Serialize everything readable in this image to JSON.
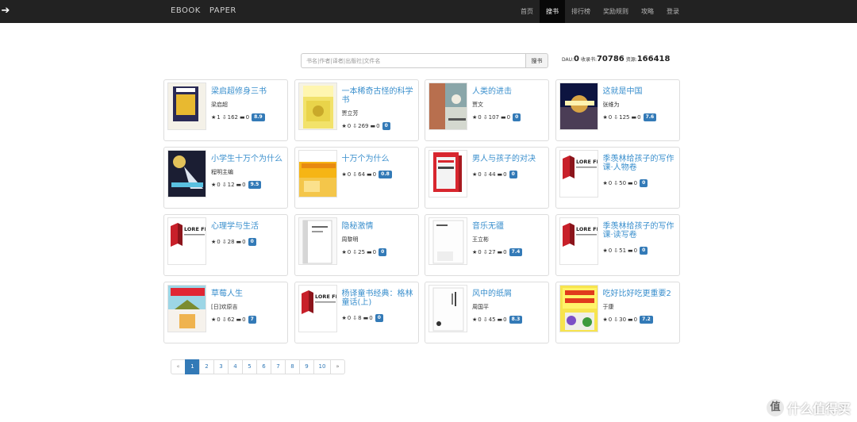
{
  "nav": {
    "back_icon": "arrow-right-icon",
    "brand": "EBOOK   PAPER",
    "items": [
      {
        "label": "首页",
        "active": false
      },
      {
        "label": "搜书",
        "active": true
      },
      {
        "label": "排行榜",
        "active": false
      },
      {
        "label": "奖励规则",
        "active": false
      },
      {
        "label": "攻略",
        "active": false
      },
      {
        "label": "登录",
        "active": false
      }
    ]
  },
  "search": {
    "placeholder": "书名|作者|译者|出版社|文件名",
    "button": "搜书"
  },
  "stats": {
    "dau_label": "DAU:",
    "dau_value": "0",
    "books_label": "收录书:",
    "books_value": "70786",
    "resources_label": "资源:",
    "resources_value": "166418"
  },
  "books": [
    {
      "title": "梁启超修身三书",
      "author": "梁启超",
      "likes": "1",
      "downloads": "162",
      "comments": "0",
      "score": "8.9",
      "cover": "purple-yellow"
    },
    {
      "title": "一本稀奇古怪的科学书",
      "author": "贾立芳",
      "likes": "0",
      "downloads": "269",
      "comments": "0",
      "score": "0",
      "cover": "yellow-book"
    },
    {
      "title": "人类的进击",
      "author": "贾文",
      "likes": "0",
      "downloads": "107",
      "comments": "0",
      "score": "0",
      "cover": "human"
    },
    {
      "title": "这就是中国",
      "author": "张维为",
      "likes": "0",
      "downloads": "125",
      "comments": "0",
      "score": "7.6",
      "cover": "china"
    },
    {
      "title": "小学生十万个为什么",
      "author": "程明主编",
      "likes": "0",
      "downloads": "12",
      "comments": "0",
      "score": "9.5",
      "cover": "space"
    },
    {
      "title": "十万个为什么",
      "author": "",
      "likes": "0",
      "downloads": "64",
      "comments": "0",
      "score": "0.8",
      "cover": "orange"
    },
    {
      "title": "男人与孩子的对决",
      "author": "",
      "likes": "0",
      "downloads": "44",
      "comments": "0",
      "score": "0",
      "cover": "red-box"
    },
    {
      "title": "季羡林给孩子的写作课·人物卷",
      "author": "",
      "likes": "0",
      "downloads": "50",
      "comments": "0",
      "score": "0",
      "cover": "lore"
    },
    {
      "title": "心理学与生活",
      "author": "",
      "likes": "0",
      "downloads": "28",
      "comments": "0",
      "score": "0",
      "cover": "lore"
    },
    {
      "title": "隐秘激情",
      "author": "周黎明",
      "likes": "0",
      "downloads": "25",
      "comments": "0",
      "score": "0",
      "cover": "white-grey"
    },
    {
      "title": "音乐无疆",
      "author": "王立彬",
      "likes": "0",
      "downloads": "27",
      "comments": "0",
      "score": "7.4",
      "cover": "white-plain"
    },
    {
      "title": "季羡林给孩子的写作课·读写卷",
      "author": "",
      "likes": "0",
      "downloads": "51",
      "comments": "0",
      "score": "0",
      "cover": "lore"
    },
    {
      "title": "草莓人生",
      "author": "[日]欢原吉",
      "likes": "0",
      "downloads": "62",
      "comments": "0",
      "score": "7",
      "cover": "strawberry"
    },
    {
      "title": "杨译童书经典：格林童话(上)",
      "author": "",
      "likes": "0",
      "downloads": "8",
      "comments": "0",
      "score": "0",
      "cover": "lore"
    },
    {
      "title": "风中的纸屑",
      "author": "周国平",
      "likes": "0",
      "downloads": "45",
      "comments": "0",
      "score": "8.3",
      "cover": "white-text"
    },
    {
      "title": "吃好比好吃更重要2",
      "author": "于康",
      "likes": "0",
      "downloads": "30",
      "comments": "0",
      "score": "7.2",
      "cover": "eat"
    }
  ],
  "lore_logo_text": "LORE FREE",
  "pagination": [
    "«",
    "1",
    "2",
    "3",
    "4",
    "5",
    "6",
    "7",
    "8",
    "9",
    "10",
    "»"
  ],
  "pagination_active": "1",
  "watermark": {
    "logo": "值",
    "text": "什么值得买"
  }
}
